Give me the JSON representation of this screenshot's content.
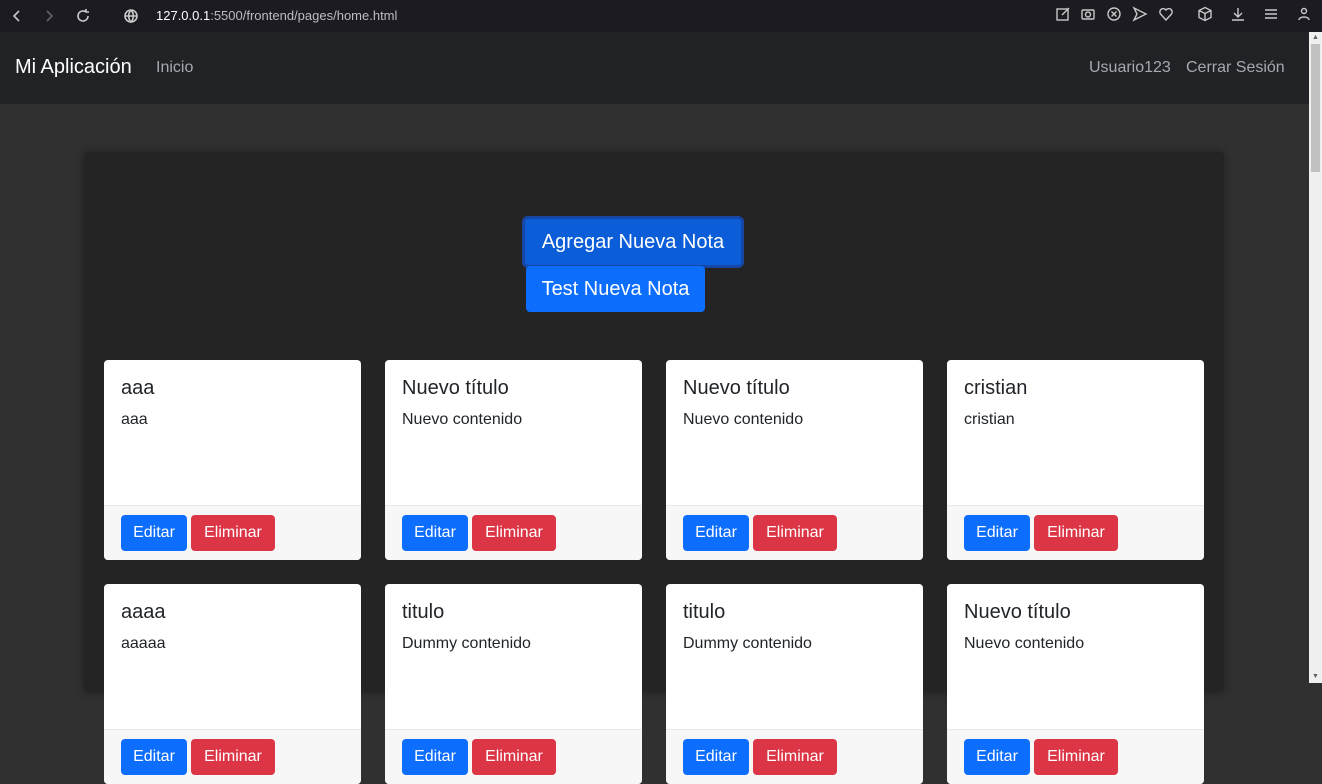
{
  "browser": {
    "url_host": "127.0.0.1",
    "url_rest": ":5500/frontend/pages/home.html"
  },
  "navbar": {
    "brand": "Mi Aplicación",
    "home_link": "Inicio",
    "user": "Usuario123",
    "logout": "Cerrar Sesión"
  },
  "actions": {
    "add_note": "Agregar Nueva Nota",
    "test_note": "Test Nueva Nota"
  },
  "card_buttons": {
    "edit": "Editar",
    "delete": "Eliminar"
  },
  "notes": [
    {
      "title": "aaa",
      "content": "aaa"
    },
    {
      "title": "Nuevo título",
      "content": "Nuevo contenido"
    },
    {
      "title": "Nuevo título",
      "content": "Nuevo contenido"
    },
    {
      "title": "cristian",
      "content": "cristian"
    },
    {
      "title": "aaaa",
      "content": "aaaaa"
    },
    {
      "title": "titulo",
      "content": "Dummy contenido"
    },
    {
      "title": "titulo",
      "content": "Dummy contenido"
    },
    {
      "title": "Nuevo título",
      "content": "Nuevo contenido"
    }
  ],
  "colors": {
    "primary": "#0d6efd",
    "danger": "#dc3545",
    "navbar": "#202225",
    "background": "#303030"
  }
}
